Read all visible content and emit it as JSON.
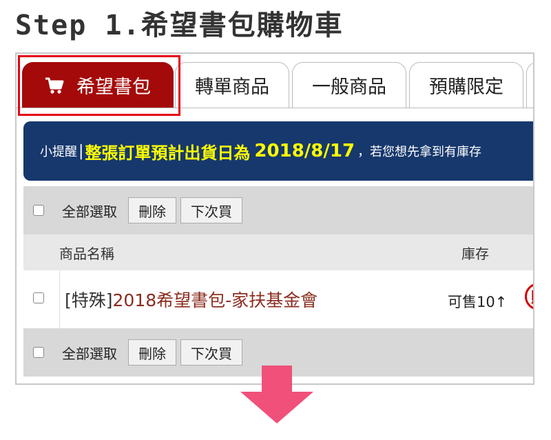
{
  "page": {
    "title": "Step 1.希望書包購物車"
  },
  "tabs": [
    {
      "label": "希望書包",
      "active": true,
      "icon": "shopping-cart-icon"
    },
    {
      "label": "轉單商品",
      "active": false
    },
    {
      "label": "一般商品",
      "active": false
    },
    {
      "label": "預購限定",
      "active": false
    }
  ],
  "notice": {
    "prefix": "小提醒",
    "separator": "|",
    "highlight": "整張訂單預計出貨日為",
    "date": "2018/8/17",
    "suffix": "，若您想先拿到有庫存"
  },
  "toolbar": {
    "select_all": "全部選取",
    "delete": "刪除",
    "buy_later": "下次買"
  },
  "table": {
    "headers": {
      "name": "商品名稱",
      "stock": "庫存"
    },
    "rows": [
      {
        "tag": "[特殊]",
        "title": "2018希望書包-家扶基金會",
        "stock": "可售10↑",
        "icon": "gift-icon"
      }
    ]
  },
  "colors": {
    "tab_active": "#a50a0a",
    "highlight_border": "#e60012",
    "notice_bg": "#17386d",
    "notice_text": "#ffff00",
    "arrow": "#f0507a"
  }
}
